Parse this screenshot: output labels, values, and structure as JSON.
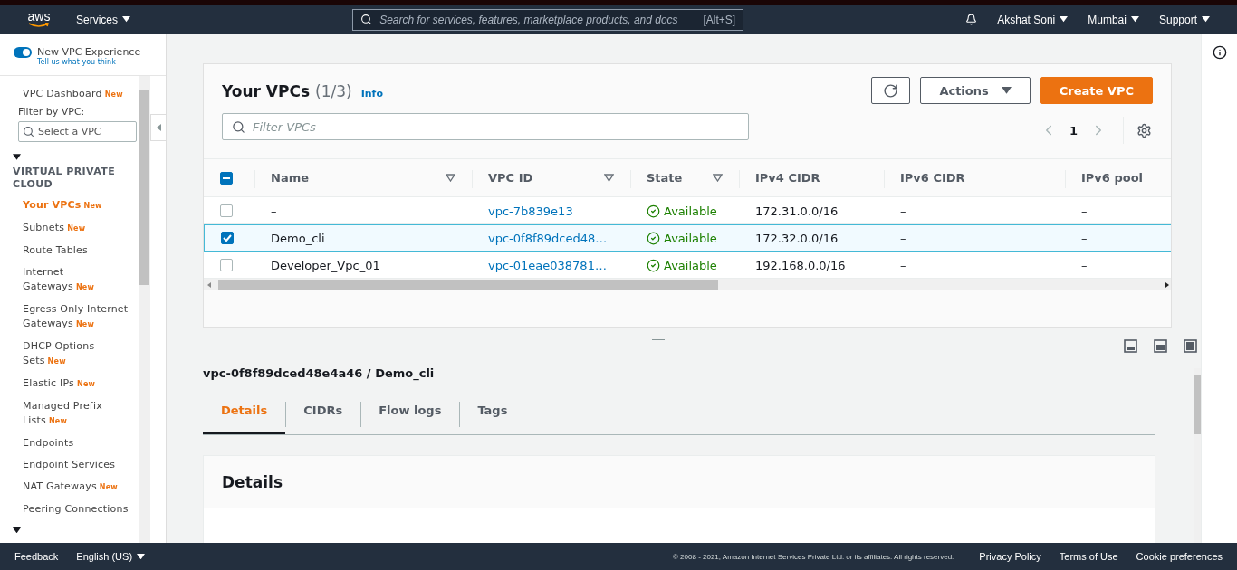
{
  "topbar": {
    "logo": "aws",
    "services": "Services",
    "search": {
      "placeholder": "Search for services, features, marketplace products, and docs",
      "shortcut": "[Alt+S]"
    },
    "user": "Akshat Soni",
    "region": "Mumbai",
    "support": "Support"
  },
  "sidebar": {
    "toggle": {
      "label": "New VPC Experience",
      "on": true,
      "link": "Tell us what you think"
    },
    "dashboard": {
      "label": "VPC Dashboard",
      "badge": "New"
    },
    "filter_label": "Filter by VPC:",
    "filter": {
      "placeholder": "Select a VPC"
    },
    "section": {
      "title": "VIRTUAL PRIVATE CLOUD",
      "expanded": true
    },
    "items": [
      {
        "label": "Your VPCs",
        "badge": "New",
        "selected": true
      },
      {
        "label": "Subnets",
        "badge": "New",
        "selected": false
      },
      {
        "label": "Route Tables",
        "selected": false
      },
      {
        "label": "Internet Gateways",
        "badge": "New",
        "selected": false
      },
      {
        "label": "Egress Only Internet Gateways",
        "badge": "New",
        "selected": false
      },
      {
        "label": "DHCP Options Sets",
        "badge": "New",
        "selected": false
      },
      {
        "label": "Elastic IPs",
        "badge": "New",
        "selected": false
      },
      {
        "label": "Managed Prefix Lists",
        "badge": "New",
        "selected": false
      },
      {
        "label": "Endpoints",
        "selected": false
      },
      {
        "label": "Endpoint Services",
        "selected": false
      },
      {
        "label": "NAT Gateways",
        "badge": "New",
        "selected": false
      },
      {
        "label": "Peering Connections",
        "selected": false
      }
    ]
  },
  "table": {
    "title": "Your VPCs",
    "count": "(1/3)",
    "info": "Info",
    "actions": "Actions",
    "create": "Create VPC",
    "filter": {
      "placeholder": "Filter VPCs"
    },
    "page": "1",
    "select_all": {
      "indeterminate": true
    },
    "columns": [
      {
        "label": "Name",
        "sortable": true
      },
      {
        "label": "VPC ID",
        "sortable": true
      },
      {
        "label": "State",
        "sortable": true
      },
      {
        "label": "IPv4 CIDR",
        "sortable": false
      },
      {
        "label": "IPv6 CIDR",
        "sortable": false
      },
      {
        "label": "IPv6 pool",
        "sortable": false
      }
    ],
    "rows": [
      {
        "checked": false,
        "name": "–",
        "vpc_id": "vpc-7b839e13",
        "state": "Available",
        "ipv4": "172.31.0.0/16",
        "ipv6": "–",
        "pool": "–"
      },
      {
        "checked": true,
        "name": "Demo_cli",
        "vpc_id": "vpc-0f8f89dced48…",
        "state": "Available",
        "ipv4": "172.32.0.0/16",
        "ipv6": "–",
        "pool": "–"
      },
      {
        "checked": false,
        "name": "Developer_Vpc_01",
        "vpc_id": "vpc-01eae038781…",
        "state": "Available",
        "ipv4": "192.168.0.0/16",
        "ipv6": "–",
        "pool": "–"
      }
    ]
  },
  "detail": {
    "title": "vpc-0f8f89dced48e4a46 / Demo_cli",
    "tabs": [
      {
        "label": "Details",
        "selected": true
      },
      {
        "label": "CIDRs",
        "selected": false
      },
      {
        "label": "Flow logs",
        "selected": false
      },
      {
        "label": "Tags",
        "selected": false
      }
    ],
    "card_title": "Details"
  },
  "footer": {
    "feedback": "Feedback",
    "language": "English (US)",
    "copyright": "© 2008 - 2021, Amazon Internet Services Private Ltd. or its affiliates. All rights reserved.",
    "links": [
      "Privacy Policy",
      "Terms of Use",
      "Cookie preferences"
    ]
  }
}
